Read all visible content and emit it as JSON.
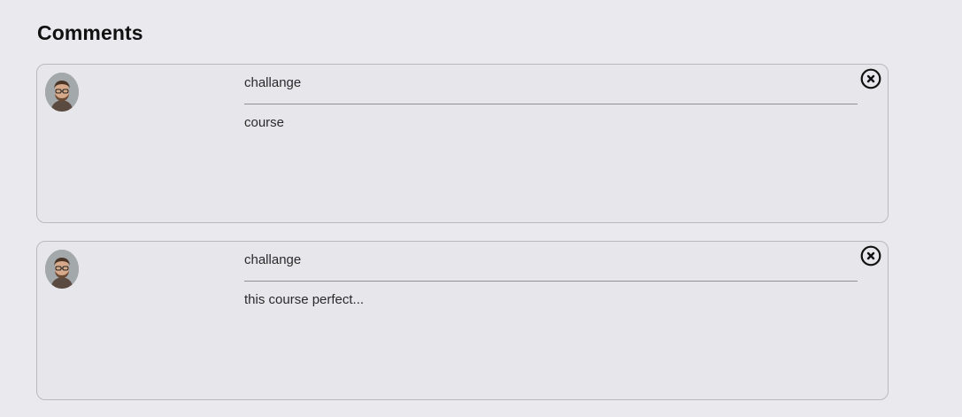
{
  "section": {
    "title": "Comments"
  },
  "comments": [
    {
      "user": "challange",
      "text": "course",
      "avatar_icon": "user-avatar-icon",
      "delete_icon": "close-circle-icon"
    },
    {
      "user": "challange",
      "text": "this course perfect...",
      "avatar_icon": "user-avatar-icon",
      "delete_icon": "close-circle-icon"
    }
  ],
  "colors": {
    "background": "#e9e9ee",
    "card_border": "#b9b9be",
    "divider": "#8f8f94",
    "icon": "#111111"
  }
}
